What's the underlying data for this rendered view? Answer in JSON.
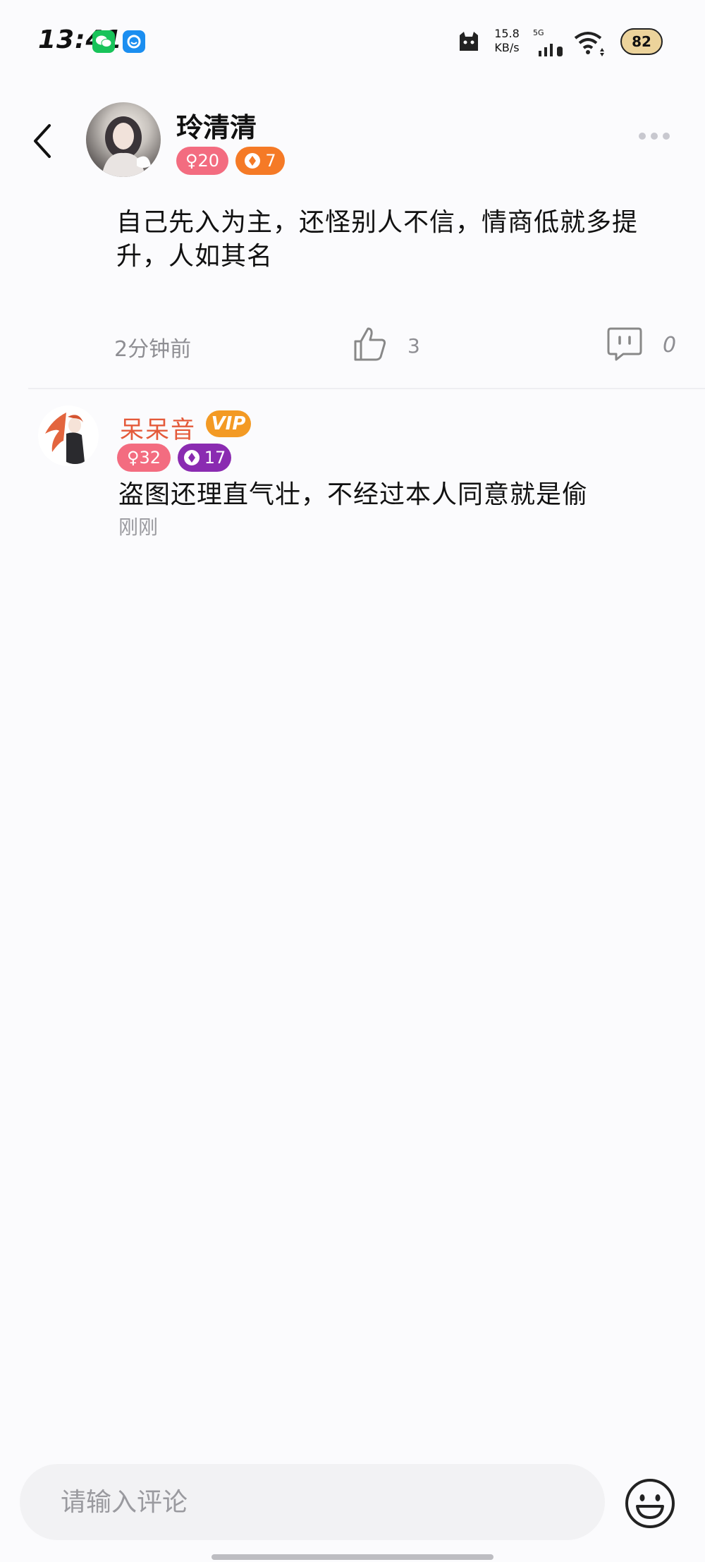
{
  "status_bar": {
    "time": "13:41",
    "net_speed_value": "15.8",
    "net_speed_unit": "KB/s",
    "network_type": "5G",
    "battery": "82"
  },
  "header": {
    "back_icon": "chevron-left-icon",
    "author_name": "玲清清",
    "gender_badge": "♀20",
    "level_badge": "7",
    "more_icon": "more-horizontal-icon"
  },
  "post": {
    "text": "自己先入为主，还怪别人不信，情商低就多提升，人如其名",
    "time": "2分钟前",
    "like_count": "3",
    "comment_count": "0"
  },
  "reply": {
    "name": "呆呆音",
    "vip": "VIP",
    "gender_badge": "♀32",
    "level_badge": "17",
    "text": "盗图还理直气壮，不经过本人同意就是偷",
    "time": "刚刚"
  },
  "comment_bar": {
    "placeholder": "请输入评论",
    "emoji_icon": "smiley-icon"
  },
  "colors": {
    "gender_badge": "#f36c80",
    "level_orange": "#f57a26",
    "level_purple": "#8a2bb1",
    "vip": "#f39a24",
    "reply_name": "#e45a3a"
  }
}
